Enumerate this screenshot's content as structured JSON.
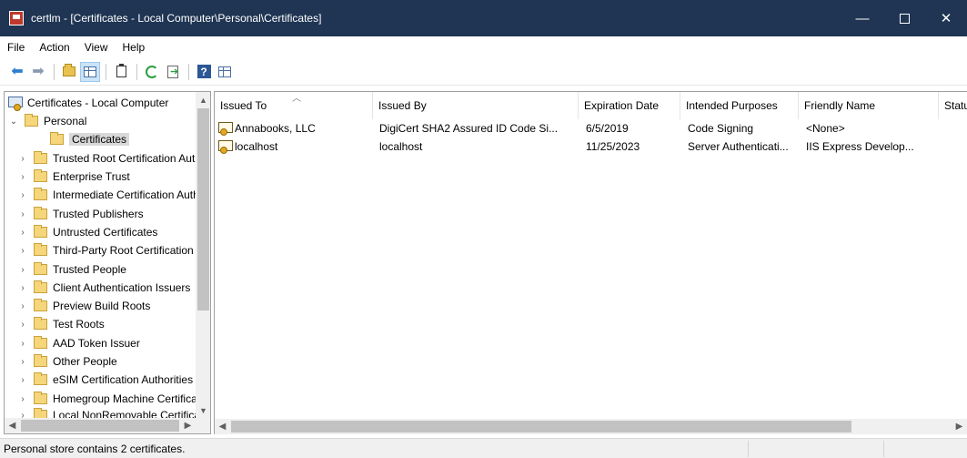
{
  "window": {
    "title": "certlm - [Certificates - Local Computer\\Personal\\Certificates]",
    "controls": {
      "minimize": "—",
      "close": "✕"
    }
  },
  "menu": [
    "File",
    "Action",
    "View",
    "Help"
  ],
  "toolbar": {
    "icons": [
      "back-icon",
      "forward-icon",
      "up-folder-icon",
      "show-hide-tree-icon",
      "properties-icon",
      "refresh-icon",
      "export-list-icon",
      "help-icon",
      "mmc-view-icon"
    ]
  },
  "tree": {
    "root": "Certificates - Local Computer",
    "items": [
      {
        "label": "Personal",
        "expanded": true
      },
      {
        "label": "Certificates",
        "selected": true
      },
      {
        "label": "Trusted Root Certification Authorities"
      },
      {
        "label": "Enterprise Trust"
      },
      {
        "label": "Intermediate Certification Authorities"
      },
      {
        "label": "Trusted Publishers"
      },
      {
        "label": "Untrusted Certificates"
      },
      {
        "label": "Third-Party Root Certification Authorities"
      },
      {
        "label": "Trusted People"
      },
      {
        "label": "Client Authentication Issuers"
      },
      {
        "label": "Preview Build Roots"
      },
      {
        "label": "Test Roots"
      },
      {
        "label": "AAD Token Issuer"
      },
      {
        "label": "Other People"
      },
      {
        "label": "eSIM Certification Authorities"
      },
      {
        "label": "Homegroup Machine Certificates"
      },
      {
        "label": "Local NonRemovable Certificates"
      }
    ]
  },
  "list": {
    "columns": [
      "Issued To",
      "Issued By",
      "Expiration Date",
      "Intended Purposes",
      "Friendly Name",
      "Status"
    ],
    "rows": [
      {
        "issued_to": "Annabooks, LLC",
        "issued_by": "DigiCert SHA2 Assured ID Code Si...",
        "expiration": "6/5/2019",
        "purposes": "Code Signing",
        "friendly": "<None>"
      },
      {
        "issued_to": "localhost",
        "issued_by": "localhost",
        "expiration": "11/25/2023",
        "purposes": "Server Authenticati...",
        "friendly": "IIS Express Develop..."
      }
    ]
  },
  "status": {
    "text": "Personal store contains 2 certificates."
  },
  "colors": {
    "titlebar": "#1f3553",
    "selection": "#d9d9d9",
    "toolbar_active": "#cce4f7"
  }
}
